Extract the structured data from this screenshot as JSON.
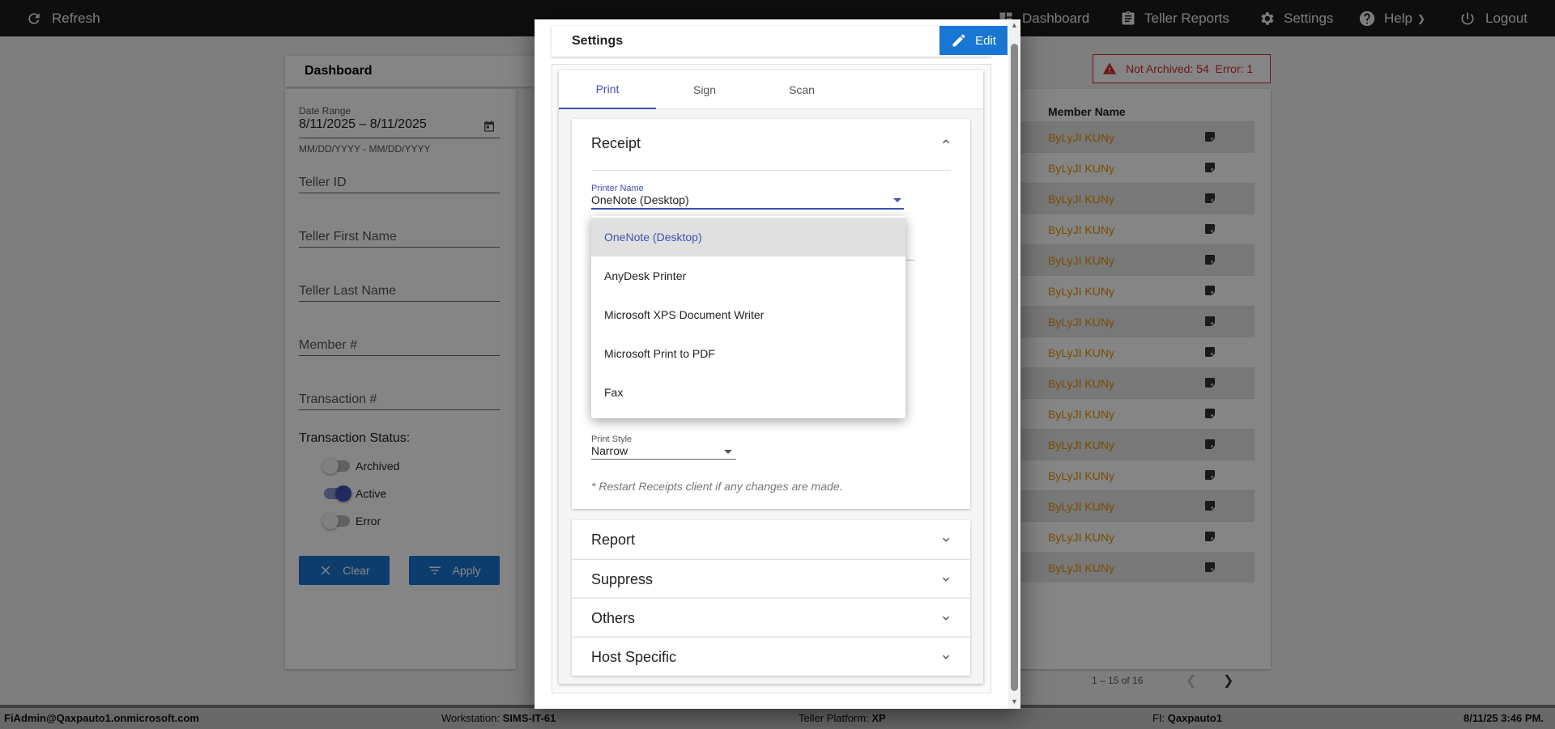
{
  "topbar": {
    "refresh": "Refresh",
    "dashboard": "Dashboard",
    "teller_reports": "Teller Reports",
    "settings": "Settings",
    "help": "Help",
    "logout": "Logout"
  },
  "dashboard": {
    "title": "Dashboard",
    "date_range_label": "Date Range",
    "date_range_value": "8/11/2025 – 8/11/2025",
    "date_hint": "MM/DD/YYYY - MM/DD/YYYY",
    "teller_id": "Teller ID",
    "teller_first": "Teller First Name",
    "teller_last": "Teller Last Name",
    "member": "Member #",
    "transaction": "Transaction #",
    "status_label": "Transaction Status:",
    "archived": "Archived",
    "active": "Active",
    "error": "Error",
    "clear": "Clear",
    "apply": "Apply"
  },
  "alert": {
    "text": "Not Archived: 54  Error: 1"
  },
  "table": {
    "header_member_name": "Member Name",
    "rows": [
      "ByLyJI KUNy",
      "ByLyJI KUNy",
      "ByLyJI KUNy",
      "ByLyJI KUNy",
      "ByLyJI KUNy",
      "ByLyJI KUNy",
      "ByLyJI KUNy",
      "ByLyJI KUNy",
      "ByLyJI KUNy",
      "ByLyJI KUNy",
      "ByLyJI KUNy",
      "ByLyJI KUNy",
      "ByLyJI KUNy",
      "ByLyJI KUNy",
      "ByLyJI KUNy"
    ],
    "pager": "1 – 15 of 16"
  },
  "statusbar": {
    "user": "FiAdmin@Qaxpauto1.onmicrosoft.com",
    "workstation_label": "Workstation:",
    "workstation": "SIMS-IT-61",
    "platform_label": "Teller Platform:",
    "platform": "XP",
    "fi_label": "FI:",
    "fi": "Qaxpauto1",
    "datetime": "8/11/25 3:46 PM."
  },
  "modal": {
    "title": "Settings",
    "edit": "Edit",
    "tabs": [
      "Print",
      "Sign",
      "Scan"
    ],
    "receipt": {
      "title": "Receipt",
      "printer_label": "Printer Name",
      "printer_value": "OneNote (Desktop)",
      "print_style_label": "Print Style",
      "print_style_value": "Narrow",
      "note": "* Restart Receipts client if any changes are made."
    },
    "panels": [
      "Report",
      "Suppress",
      "Others",
      "Host Specific"
    ]
  },
  "dropdown": {
    "options": [
      "OneNote (Desktop)",
      "AnyDesk Printer",
      "Microsoft XPS Document Writer",
      "Microsoft Print to PDF",
      "Fax"
    ]
  }
}
